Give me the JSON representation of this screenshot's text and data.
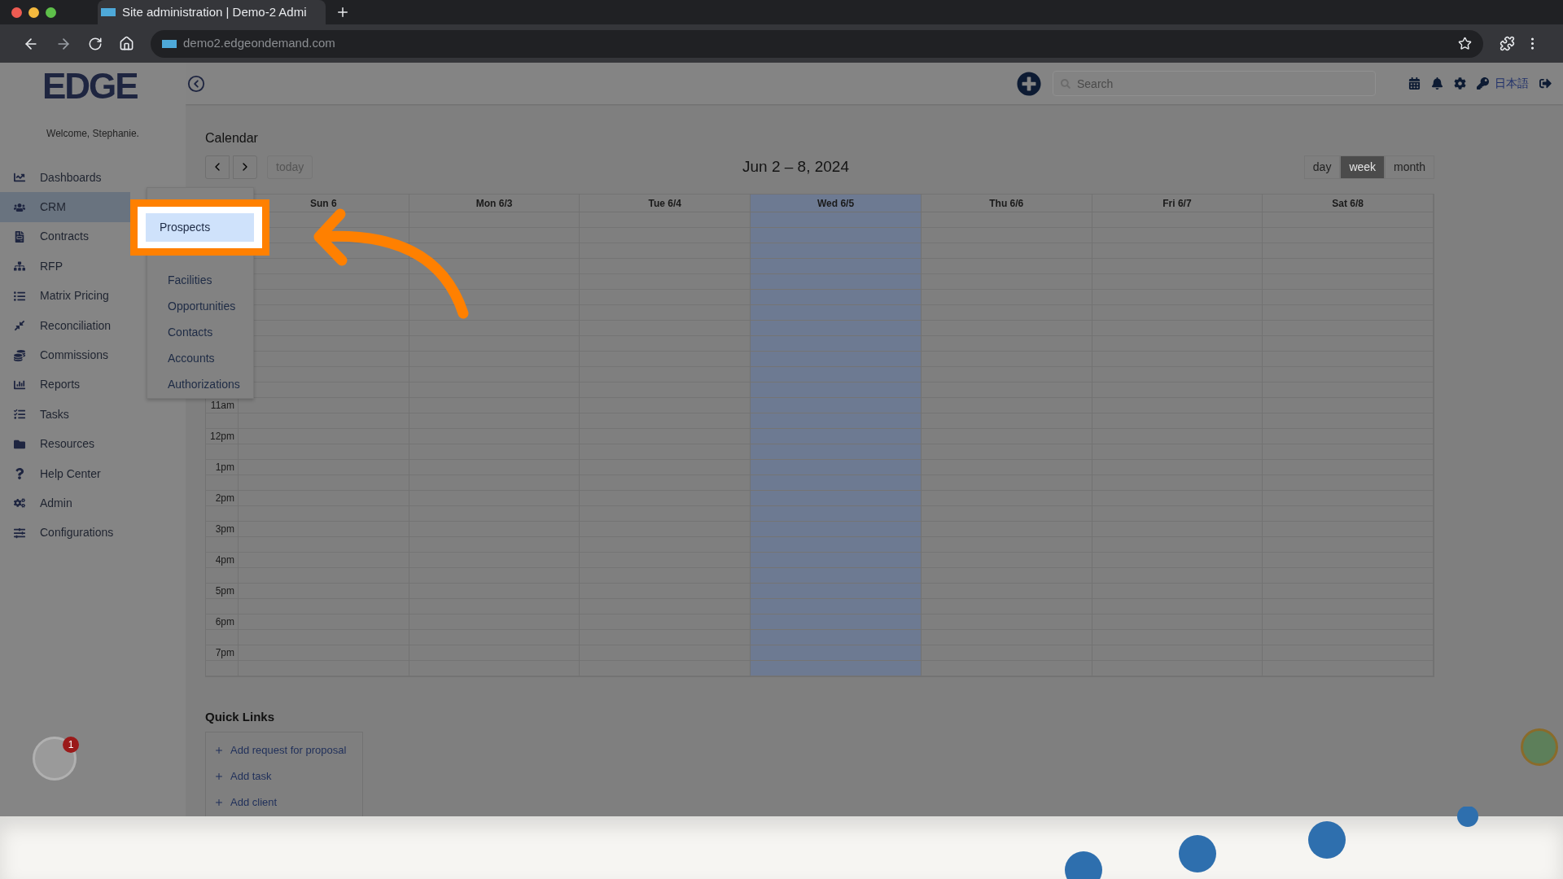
{
  "browser": {
    "tab_title": "Site administration | Demo-2 Admi",
    "url": "demo2.edgeondemand.com"
  },
  "header": {
    "search": {
      "placeholder": "Search"
    },
    "language": "日本語"
  },
  "sidebar": {
    "logo": "EDGE",
    "welcome": "Welcome, Stephanie.",
    "notification_count": "1",
    "items": [
      {
        "label": "Dashboards",
        "selected": false
      },
      {
        "label": "CRM",
        "selected": true
      },
      {
        "label": "Contracts",
        "selected": false
      },
      {
        "label": "RFP",
        "selected": false
      },
      {
        "label": "Matrix Pricing",
        "selected": false
      },
      {
        "label": "Reconciliation",
        "selected": false
      },
      {
        "label": "Commissions",
        "selected": false
      },
      {
        "label": "Reports",
        "selected": false
      },
      {
        "label": "Tasks",
        "selected": false
      },
      {
        "label": "Resources",
        "selected": false
      },
      {
        "label": "Help Center",
        "selected": false
      },
      {
        "label": "Admin",
        "selected": false
      },
      {
        "label": "Configurations",
        "selected": false
      }
    ]
  },
  "crm_menu": {
    "items": [
      {
        "label": "Prospects",
        "selected": true
      },
      {
        "label": "Facilities",
        "selected": false
      },
      {
        "label": "Opportunities",
        "selected": false
      },
      {
        "label": "Contacts",
        "selected": false
      },
      {
        "label": "Accounts",
        "selected": false
      },
      {
        "label": "Authorizations",
        "selected": false
      }
    ]
  },
  "calendar": {
    "title": "Calendar",
    "today_button": "today",
    "range": "Jun 2 – 8, 2024",
    "views": [
      {
        "label": "day",
        "selected": false
      },
      {
        "label": "week",
        "selected": true
      },
      {
        "label": "month",
        "selected": false
      }
    ],
    "days": [
      {
        "label": "Sun 6",
        "selected": false
      },
      {
        "label": "Mon 6/3",
        "selected": false
      },
      {
        "label": "Tue 6/4",
        "selected": false
      },
      {
        "label": "Wed 6/5",
        "selected": true
      },
      {
        "label": "Thu 6/6",
        "selected": false
      },
      {
        "label": "Fri 6/7",
        "selected": false
      },
      {
        "label": "Sat 6/8",
        "selected": false
      }
    ],
    "hours": [
      "11am",
      "12pm",
      "1pm",
      "2pm",
      "3pm",
      "4pm",
      "5pm",
      "6pm",
      "7pm"
    ]
  },
  "quick_links": {
    "title": "Quick Links",
    "items": [
      "Add request for proposal",
      "Add task",
      "Add client"
    ]
  }
}
